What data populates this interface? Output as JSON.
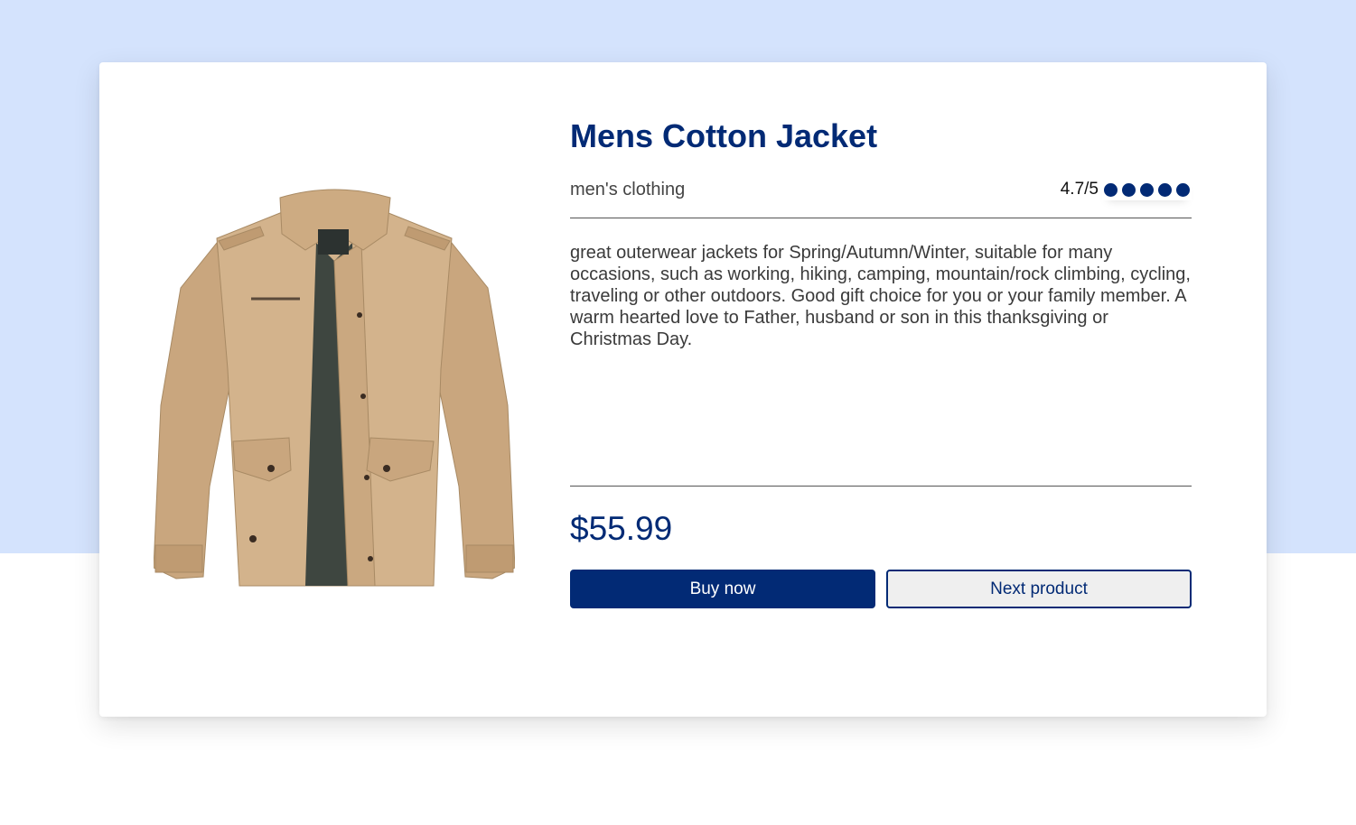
{
  "product": {
    "title": "Mens Cotton Jacket",
    "category": "men's clothing",
    "rating_text": "4.7/5",
    "rating_value": 4.7,
    "rating_max": 5,
    "description": "great outerwear jackets for Spring/Autumn/Winter, suitable for many occasions, such as working, hiking, camping, mountain/rock climbing, cycling, traveling or other outdoors. Good gift choice for you or your family member. A warm hearted love to Father, husband or son in this thanksgiving or Christmas Day.",
    "price": "$55.99"
  },
  "actions": {
    "buy_label": "Buy now",
    "next_label": "Next product"
  },
  "colors": {
    "accent": "#022a75",
    "background_top": "#d4e3fd",
    "jacket": "#d3b38c"
  }
}
